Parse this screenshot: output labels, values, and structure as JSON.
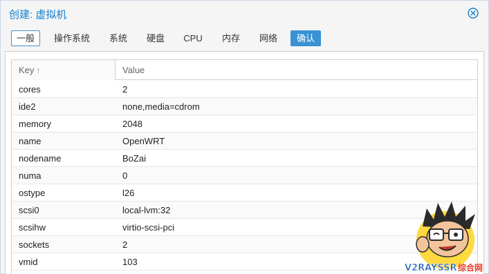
{
  "window": {
    "title": "创建: 虚拟机",
    "close_icon": "close-circle-icon"
  },
  "tabs": [
    {
      "label": "一般",
      "state": "active"
    },
    {
      "label": "操作系统",
      "state": "normal"
    },
    {
      "label": "系统",
      "state": "normal"
    },
    {
      "label": "硬盘",
      "state": "normal"
    },
    {
      "label": "CPU",
      "state": "normal"
    },
    {
      "label": "内存",
      "state": "normal"
    },
    {
      "label": "网络",
      "state": "normal"
    },
    {
      "label": "确认",
      "state": "confirm"
    }
  ],
  "grid": {
    "columns": {
      "key": "Key",
      "value": "Value",
      "sort_icon": "arrow-up-icon"
    },
    "rows": [
      {
        "key": "cores",
        "value": "2"
      },
      {
        "key": "ide2",
        "value": "none,media=cdrom"
      },
      {
        "key": "memory",
        "value": "2048"
      },
      {
        "key": "name",
        "value": "OpenWRT"
      },
      {
        "key": "nodename",
        "value": "BoZai"
      },
      {
        "key": "numa",
        "value": "0"
      },
      {
        "key": "ostype",
        "value": "l26"
      },
      {
        "key": "scsi0",
        "value": "local-lvm:32"
      },
      {
        "key": "scsihw",
        "value": "virtio-scsi-pci"
      },
      {
        "key": "sockets",
        "value": "2"
      },
      {
        "key": "vmid",
        "value": "103"
      }
    ]
  },
  "watermark": {
    "text": "V2RAYSSR综合网"
  },
  "colors": {
    "accent": "#157fcc",
    "confirm_tab": "#3892d4",
    "active_tab_border": "#4a8dc7"
  }
}
